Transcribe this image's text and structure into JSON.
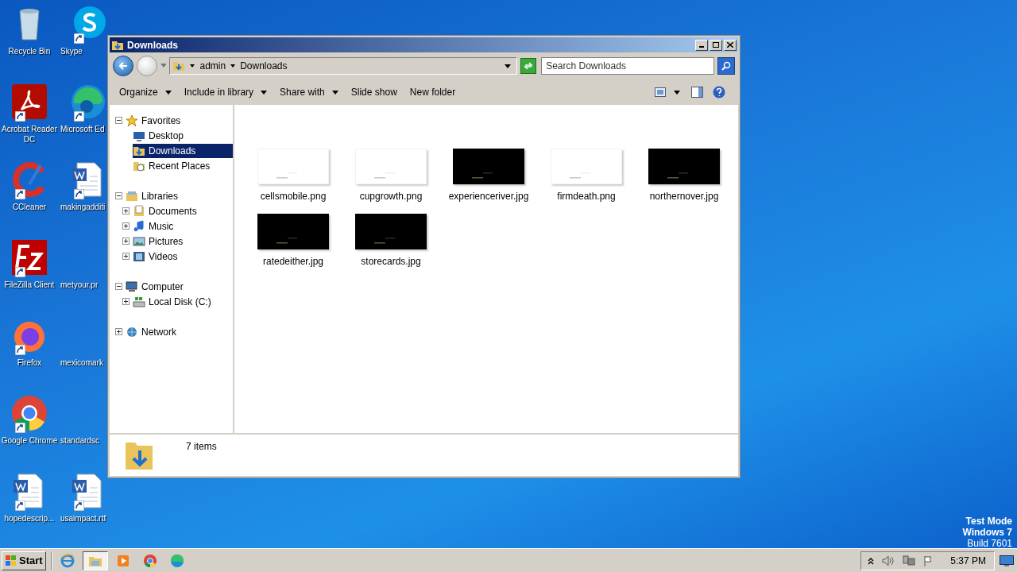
{
  "desktop_icons": [
    {
      "label": "Recycle Bin",
      "kind": "bin"
    },
    {
      "label": "Acrobat Reader DC",
      "kind": "acrobat"
    },
    {
      "label": "CCleaner",
      "kind": "ccleaner"
    },
    {
      "label": "FileZilla Client",
      "kind": "filezilla"
    },
    {
      "label": "Firefox",
      "kind": "firefox"
    },
    {
      "label": "Google Chrome",
      "kind": "chrome"
    },
    {
      "label": "hopedescrip...",
      "kind": "word"
    },
    {
      "label": "Skype",
      "kind": "skype"
    },
    {
      "label": "Microsoft Ed",
      "kind": "edge"
    },
    {
      "label": "makingadditi",
      "kind": "word"
    },
    {
      "label": "metyour.pr",
      "kind": "blank"
    },
    {
      "label": "mexicomark",
      "kind": "blank"
    },
    {
      "label": "standardsc",
      "kind": "blank"
    },
    {
      "label": "usaimpact.rtf",
      "kind": "word"
    }
  ],
  "window": {
    "title": "Downloads",
    "breadcrumb": [
      "admin",
      "Downloads"
    ],
    "search": {
      "placeholder": "Search Downloads"
    },
    "toolbar": [
      {
        "label": "Organize",
        "menu": true
      },
      {
        "label": "Include in library",
        "menu": true
      },
      {
        "label": "Share with",
        "menu": true
      },
      {
        "label": "Slide show",
        "menu": false
      },
      {
        "label": "New folder",
        "menu": false
      }
    ],
    "nav": [
      {
        "label": "Favorites",
        "kind": "star",
        "expanded": true,
        "selected": false,
        "children": [
          {
            "label": "Desktop",
            "kind": "desktop",
            "selected": false
          },
          {
            "label": "Downloads",
            "kind": "downloads",
            "selected": true
          },
          {
            "label": "Recent Places",
            "kind": "recent",
            "selected": false
          }
        ]
      },
      {
        "label": "Libraries",
        "kind": "library",
        "expanded": true,
        "selected": false,
        "children": [
          {
            "label": "Documents",
            "kind": "documents",
            "expanded": false,
            "selected": false
          },
          {
            "label": "Music",
            "kind": "music",
            "expanded": false,
            "selected": false
          },
          {
            "label": "Pictures",
            "kind": "pictures",
            "expanded": false,
            "selected": false
          },
          {
            "label": "Videos",
            "kind": "videos",
            "expanded": false,
            "selected": false
          }
        ]
      },
      {
        "label": "Computer",
        "kind": "computer",
        "expanded": true,
        "selected": false,
        "children": [
          {
            "label": "Local Disk (C:)",
            "kind": "disk",
            "expanded": false,
            "selected": false
          }
        ]
      },
      {
        "label": "Network",
        "kind": "network",
        "expanded": false,
        "selected": false
      }
    ],
    "files": [
      {
        "name": "cellsmobile.png"
      },
      {
        "name": "cupgrowth.png"
      },
      {
        "name": "experienceriver.jpg"
      },
      {
        "name": "firmdeath.png"
      },
      {
        "name": "northernover.jpg"
      },
      {
        "name": "ratedeither.jpg"
      },
      {
        "name": "storecards.jpg"
      }
    ],
    "status": "7 items"
  },
  "taskbar": {
    "start": "Start",
    "apps": [
      {
        "kind": "ie",
        "selected": false
      },
      {
        "kind": "explorer",
        "selected": true
      },
      {
        "kind": "media",
        "selected": false
      },
      {
        "kind": "chrome",
        "selected": false
      },
      {
        "kind": "edge",
        "selected": false
      }
    ],
    "clock": "5:37 PM"
  },
  "os_notice": [
    "Test Mode",
    "Windows 7",
    "Build 7601"
  ]
}
